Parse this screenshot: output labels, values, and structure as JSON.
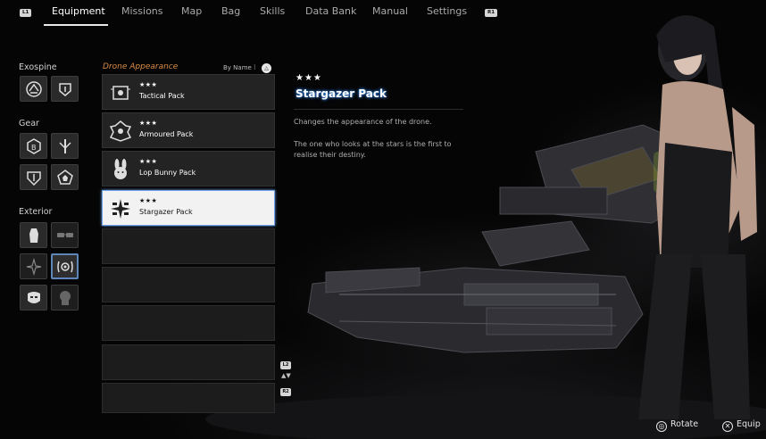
{
  "nav": {
    "left_hint": "L1",
    "right_hint": "R1",
    "tabs": [
      {
        "label": "Equipment",
        "active": true
      },
      {
        "label": "Missions",
        "active": false
      },
      {
        "label": "Map",
        "active": false
      },
      {
        "label": "Bag",
        "active": false
      },
      {
        "label": "Skills",
        "active": false
      },
      {
        "label": "Data Bank",
        "active": false
      },
      {
        "label": "Manual",
        "active": false
      },
      {
        "label": "Settings",
        "active": false
      }
    ]
  },
  "categories": {
    "exospine": {
      "title": "Exospine",
      "slots": [
        "exospine-primary-icon",
        "exospine-secondary-icon"
      ]
    },
    "gear": {
      "title": "Gear",
      "slots": [
        "gear-emblem-icon",
        "gear-blade-icon",
        "gear-shield-icon",
        "gear-pentagon-icon"
      ]
    },
    "exterior": {
      "title": "Exterior",
      "slots": [
        "exterior-suit-icon",
        "exterior-glasses-icon",
        "exterior-hair-icon",
        "exterior-drone-icon",
        "exterior-mask-icon",
        "exterior-helmet-icon"
      ],
      "selected": "exterior-drone-icon"
    }
  },
  "list": {
    "header": "Drone Appearance",
    "sort_label": "By Name",
    "sort_button": "△",
    "items": [
      {
        "stars": "★★★",
        "name": "Tactical Pack",
        "icon": "tactical-pack-icon",
        "selected": false
      },
      {
        "stars": "★★★",
        "name": "Armoured Pack",
        "icon": "armoured-pack-icon",
        "selected": false
      },
      {
        "stars": "★★★",
        "name": "Lop Bunny Pack",
        "icon": "bunny-pack-icon",
        "selected": false
      },
      {
        "stars": "★★★",
        "name": "Stargazer Pack",
        "icon": "stargazer-pack-icon",
        "selected": true
      }
    ],
    "empty_rows": 5,
    "scroll_up_hint": "L2",
    "scroll_down_hint": "R2",
    "scroll_arrows": "▲▼"
  },
  "detail": {
    "stars": "★★★",
    "title": "Stargazer Pack",
    "description_1": "Changes the appearance of the drone.",
    "description_2": "The one who looks at the stars is the first to realise their destiny."
  },
  "hints": {
    "rotate_glyph": "◎",
    "rotate_label": "Rotate",
    "equip_glyph": "✕",
    "equip_label": "Equip"
  },
  "colors": {
    "accent_orange": "#d98a43",
    "selection_blue": "#6fa2e8",
    "title_glow": "#2f7bd9",
    "drone_core_green": "#c8ff2a"
  }
}
